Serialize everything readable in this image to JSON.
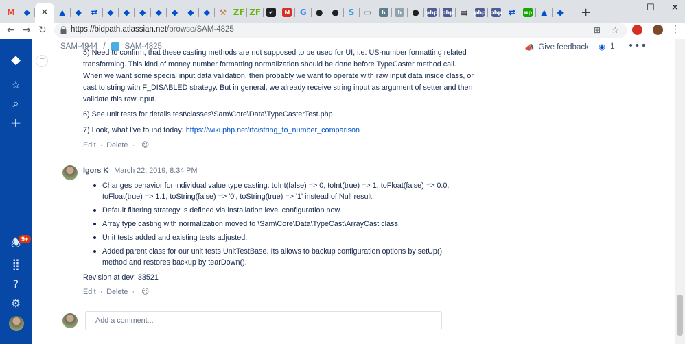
{
  "browser": {
    "tabs": [
      {
        "icon": "gmail-icon",
        "glyph": "M",
        "color": "#ea4335",
        "bg": "transparent"
      },
      {
        "icon": "jira-icon",
        "glyph": "◆",
        "color": "#0052cc",
        "bg": "transparent"
      },
      {
        "icon": "confluence-icon",
        "glyph": "▲",
        "color": "#0052cc",
        "bg": "transparent"
      },
      {
        "icon": "jira-icon",
        "glyph": "◆",
        "color": "#0052cc",
        "bg": "transparent"
      },
      {
        "icon": "sync-icon",
        "glyph": "⇄",
        "color": "#0052cc",
        "bg": "transparent"
      },
      {
        "icon": "jira-icon",
        "glyph": "◆",
        "color": "#0052cc",
        "bg": "transparent"
      },
      {
        "icon": "jira-icon",
        "glyph": "◆",
        "color": "#0052cc",
        "bg": "transparent"
      },
      {
        "icon": "jira-icon",
        "glyph": "◆",
        "color": "#0052cc",
        "bg": "transparent"
      },
      {
        "icon": "jira-icon",
        "glyph": "◆",
        "color": "#0052cc",
        "bg": "transparent"
      },
      {
        "icon": "jira-icon",
        "glyph": "◆",
        "color": "#0052cc",
        "bg": "transparent"
      },
      {
        "icon": "jira-icon",
        "glyph": "◆",
        "color": "#0052cc",
        "bg": "transparent"
      },
      {
        "icon": "jira-icon",
        "glyph": "◆",
        "color": "#0052cc",
        "bg": "transparent"
      },
      {
        "icon": "hammer-icon",
        "glyph": "⚒",
        "color": "#c97a3a",
        "bg": "transparent"
      },
      {
        "icon": "zf-icon",
        "glyph": "ZF",
        "color": "#68b604",
        "bg": "transparent"
      },
      {
        "icon": "zf-icon",
        "glyph": "ZF",
        "color": "#68b604",
        "bg": "transparent"
      },
      {
        "icon": "check-icon",
        "glyph": "✔",
        "color": "#fff",
        "bg": "#202124"
      },
      {
        "icon": "m-icon",
        "glyph": "M",
        "color": "#fff",
        "bg": "#d93025"
      },
      {
        "icon": "google-icon",
        "glyph": "G",
        "color": "#4285f4",
        "bg": "transparent"
      },
      {
        "icon": "github-icon",
        "glyph": "●",
        "color": "#202124",
        "bg": "transparent"
      },
      {
        "icon": "github-icon",
        "glyph": "●",
        "color": "#202124",
        "bg": "transparent"
      },
      {
        "icon": "s-icon",
        "glyph": "S",
        "color": "#2d9cdb",
        "bg": "transparent"
      },
      {
        "icon": "doc-icon",
        "glyph": "▭",
        "color": "#5f6368",
        "bg": "transparent"
      },
      {
        "icon": "h-icon",
        "glyph": "h",
        "color": "#fff",
        "bg": "#607d8b"
      },
      {
        "icon": "h-icon",
        "glyph": "h",
        "color": "#fff",
        "bg": "#90a4ae"
      },
      {
        "icon": "github-icon",
        "glyph": "●",
        "color": "#202124",
        "bg": "transparent"
      },
      {
        "icon": "php-icon",
        "glyph": "php",
        "color": "#fff",
        "bg": "#4f5b93"
      },
      {
        "icon": "php-icon",
        "glyph": "php",
        "color": "#fff",
        "bg": "#4f5b93"
      },
      {
        "icon": "news-icon",
        "glyph": "▤",
        "color": "#202124",
        "bg": "transparent"
      },
      {
        "icon": "php-icon",
        "glyph": "php",
        "color": "#fff",
        "bg": "#4f5b93"
      },
      {
        "icon": "php-icon",
        "glyph": "php",
        "color": "#fff",
        "bg": "#4f5b93"
      },
      {
        "icon": "sync-icon",
        "glyph": "⇄",
        "color": "#0052cc",
        "bg": "transparent"
      },
      {
        "icon": "upwork-icon",
        "glyph": "up",
        "color": "#fff",
        "bg": "#14a800"
      },
      {
        "icon": "confluence-icon",
        "glyph": "▲",
        "color": "#0052cc",
        "bg": "transparent"
      },
      {
        "icon": "jira-icon",
        "glyph": "◆",
        "color": "#0052cc",
        "bg": "transparent"
      }
    ],
    "url_host": "https://bidpath.atlassian.net",
    "url_path": "/browse/SAM-4825",
    "profile_initial": "I"
  },
  "issue": {
    "breadcrumb_parent": "SAM-4944",
    "breadcrumb_sep": "/",
    "breadcrumb_current": "SAM-4825",
    "give_feedback": "Give feedback",
    "watch_count": "1"
  },
  "comment1": {
    "lines": [
      "5) Need to confirm, that these casting methods are not supposed to be used for UI, i.e. US-number formatting related",
      "transforming. This kind of money number formatting normalization should be done before TypeCaster method call.",
      "When we want some special input data validation, then probably we want to operate with raw input data inside class, or",
      "cast to string with F_DISABLED strategy. But in general, we already receive string input as argument of setter and then",
      "validate this raw input."
    ],
    "item6": "6) See unit tests for details test\\classes\\Sam\\Core\\Data\\TypeCasterTest.php",
    "item7_prefix": "7) Look, what I've found today: ",
    "item7_link": "https://wiki.php.net/rfc/string_to_number_comparison",
    "edit": "Edit",
    "delete": "Delete",
    "dot": "·"
  },
  "comment2": {
    "author": "Igors K",
    "time": "March 22, 2019, 8:34 PM",
    "bullets": [
      "Changes behavior for individual value type casting: toInt(false) => 0, toInt(true) => 1, toFloat(false) => 0.0, toFloat(true) => 1.1, toString(false) => '0', toString(true) => '1' instead of Null result.",
      "Default filtering strategy is defined via installation level configuration now.",
      "Array type casting with normalization moved to \\Sam\\Core\\Data\\TypeCast\\ArrayCast class.",
      "Unit tests added and existing tests adjusted.",
      "Added parent class for our unit tests UnitTestBase. Its allows to backup configuration options by setUp() method and restores backup by tearDown()."
    ],
    "revision": "Revision at dev: 33521",
    "edit": "Edit",
    "delete": "Delete",
    "dot": "·"
  },
  "add_comment": {
    "placeholder": "Add a comment..."
  },
  "sidebar": {
    "notification_badge": "9+"
  }
}
